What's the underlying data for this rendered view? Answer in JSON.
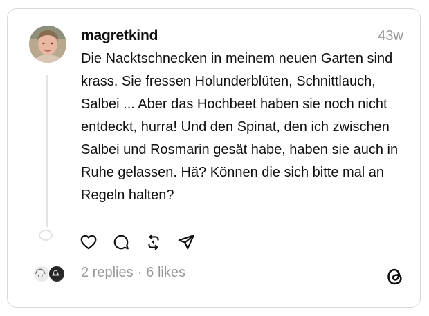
{
  "post": {
    "username": "magretkind",
    "timestamp": "43w",
    "text": "Die Nacktschnecken in meinem neuen Garten sind krass. Sie fressen Holunderblüten, Schnittlauch, Salbei ... Aber das Hochbeet haben sie noch nicht entdeckt, hurra! Und den Spinat, den ich zwischen Salbei und Rosmarin gesät habe, haben sie auch in Ruhe gelassen. Hä? Können die sich bitte mal an Regeln halten?"
  },
  "actions": {
    "icons": [
      "heart-icon",
      "comment-icon",
      "repost-icon",
      "share-icon"
    ]
  },
  "stats": {
    "replies": "2 replies",
    "separator": "·",
    "likes": "6 likes"
  },
  "brand": {
    "logo": "threads-logo-icon"
  },
  "colors": {
    "text": "#101010",
    "muted": "#999999",
    "border": "#d9d9d9",
    "thread_line": "#e3e3e3"
  }
}
